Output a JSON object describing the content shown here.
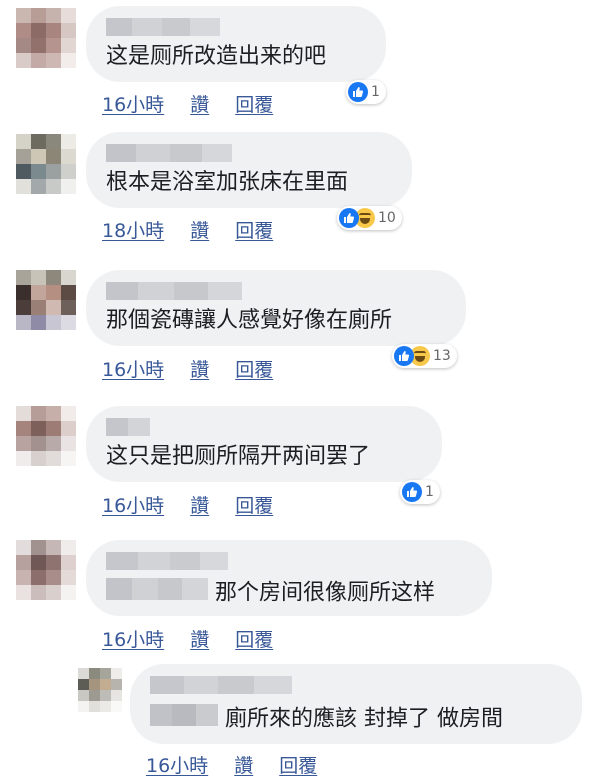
{
  "comments": [
    {
      "text": "这是厕所改造出来的吧",
      "time": "16小時",
      "like": "讚",
      "reply": "回覆",
      "reaction_count": "1"
    },
    {
      "text": "根本是浴室加张床在里面",
      "time": "18小時",
      "like": "讚",
      "reply": "回覆",
      "reaction_count": "10"
    },
    {
      "text": "那個瓷磚讓人感覺好像在廁所",
      "time": "16小時",
      "like": "讚",
      "reply": "回覆",
      "reaction_count": "13"
    },
    {
      "text": "这只是把厕所隔开两间罢了",
      "time": "16小時",
      "like": "讚",
      "reply": "回覆",
      "reaction_count": "1"
    },
    {
      "text": "那个房间很像厕所这样",
      "time": "16小時",
      "like": "讚",
      "reply": "回覆"
    },
    {
      "text": "廁所來的應該 封掉了 做房間",
      "time": "16小時",
      "like": "讚",
      "reply": "回覆"
    }
  ],
  "reactions": {
    "like_icon": "like-thumb-icon",
    "haha_icon": "haha-face-icon",
    "like_color": "#1877f2",
    "haha_color": "#f7c84a"
  },
  "colors": {
    "link": "#385898",
    "bubble": "#f0f1f3",
    "text": "#1c1e21"
  }
}
